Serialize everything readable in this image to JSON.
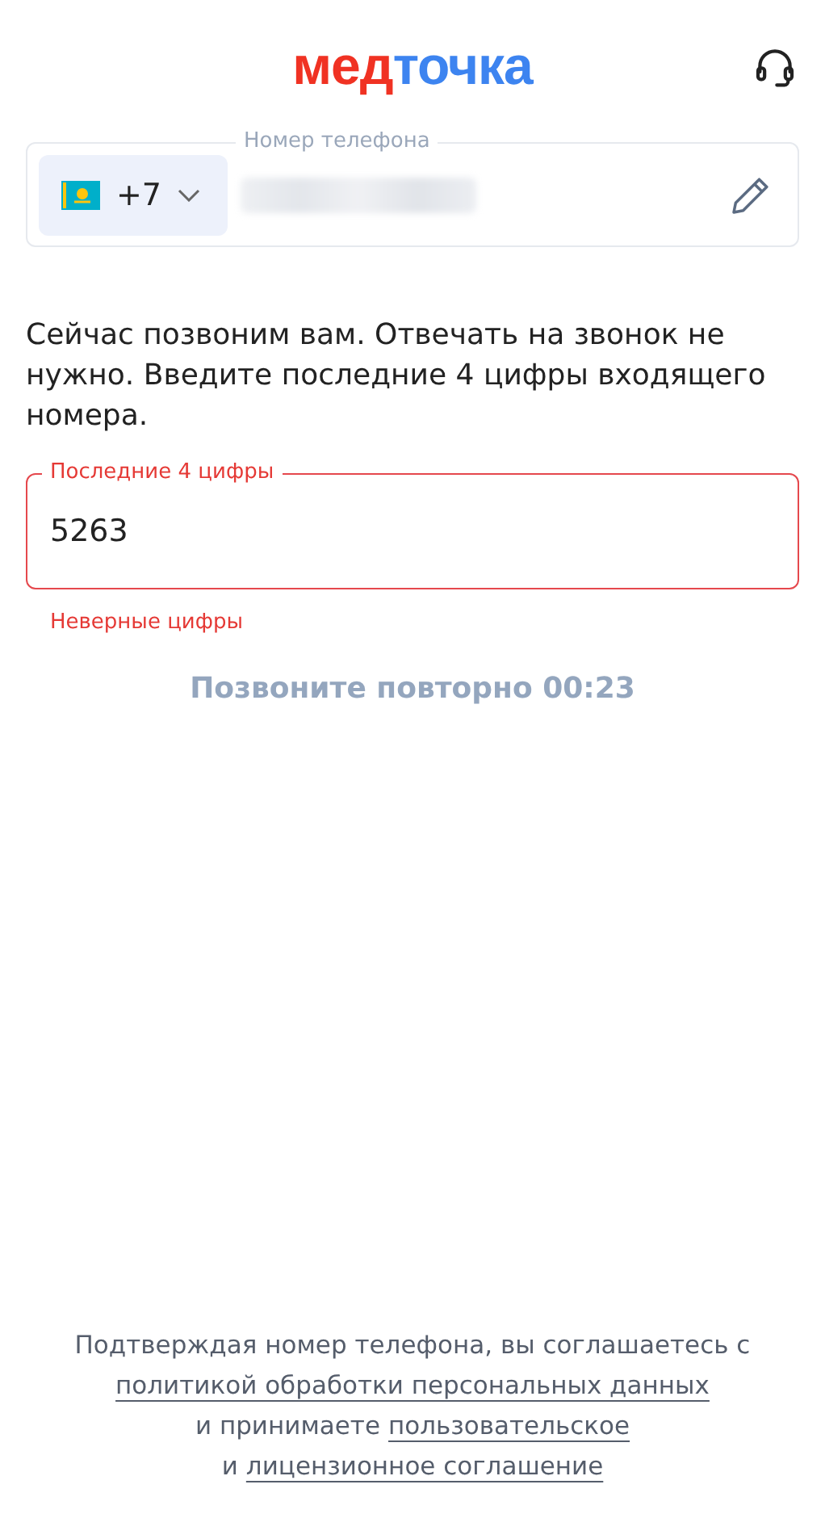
{
  "header": {
    "logo": [
      {
        "text": "мед",
        "color": "#f03223"
      },
      {
        "text": "точка",
        "color": "#3d84f0"
      }
    ]
  },
  "phone": {
    "label": "Номер телефона",
    "country_code": "+7",
    "masked": true
  },
  "instructions": "Сейчас позвоним вам. Отвечать на звонок не нужно. Введите последние 4 цифры входящего номера.",
  "code_field": {
    "label": "Последние 4 цифры",
    "value": "5263",
    "error": true,
    "error_text": "Неверные цифры"
  },
  "resend": {
    "label": "Позвоните повторно 00:23",
    "disabled": true
  },
  "footer": {
    "lines": [
      [
        {
          "kind": "text",
          "text": "Подтверждая номер телефона, вы соглашаетесь с"
        }
      ],
      [
        {
          "kind": "link",
          "text": "политикой обработки персональных данных"
        }
      ],
      [
        {
          "kind": "text",
          "text": "и принимаете"
        },
        {
          "kind": "link",
          "text": "пользовательское"
        }
      ],
      [
        {
          "kind": "text",
          "text": "и"
        },
        {
          "kind": "link",
          "text": "лицензионное соглашение"
        }
      ]
    ]
  }
}
